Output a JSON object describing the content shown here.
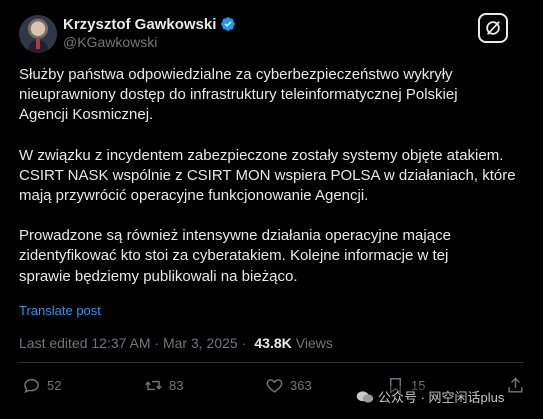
{
  "author": {
    "name": "Krzysztof Gawkowski",
    "handle": "@KGawkowski"
  },
  "post": {
    "paragraphs": [
      "Służby państwa odpowiedzialne za cyberbezpieczeństwo wykryły\nnieuprawniony dostęp do infrastruktury teleinformatycznej Polskiej\nAgencji Kosmicznej.",
      "W związku z incydentem zabezpieczone zostały systemy objęte atakiem.\nCSIRT NASK wspólnie z CSIRT MON wspiera POLSA w działaniach, które\nmają przywrócić operacyjne funkcjonowanie Agencji.",
      "Prowadzone są również intensywne działania operacyjne mające\nzidentyfikować kto stoi za cyberatakiem. Kolejne informacje w tej\nsprawie będziemy publikowali na bieżąco."
    ],
    "translate_label": "Translate post",
    "edited": "Last edited 12:37 AM · Mar 3, 2025",
    "separator": "·",
    "views_count": "43.8K",
    "views_label": "Views"
  },
  "actions": {
    "replies": "52",
    "reposts": "83",
    "likes": "363",
    "bookmarks": "15"
  },
  "watermark": {
    "text": "公众号 · 网空闲话plus"
  },
  "colors": {
    "accent": "#1d9bf0",
    "text": "#e7e9ea",
    "muted": "#71767b",
    "background": "#000000"
  }
}
